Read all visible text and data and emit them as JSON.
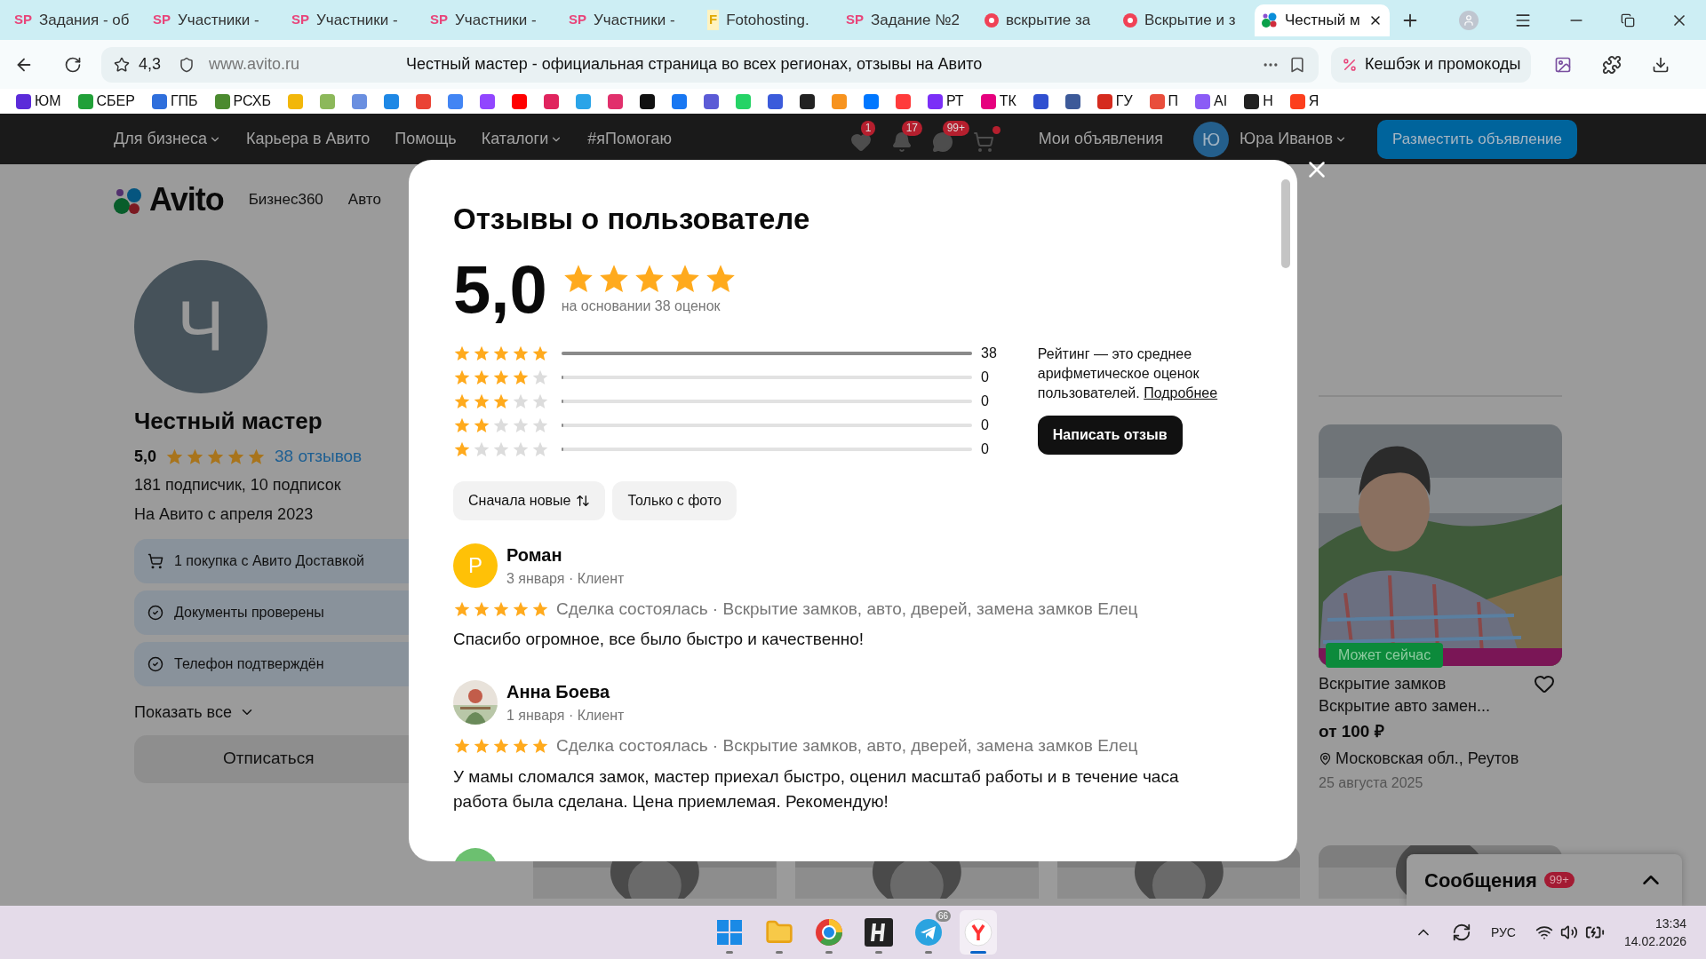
{
  "browser": {
    "tabs": [
      {
        "label": "Задания - об",
        "kind": "letters",
        "icon_text": "SP",
        "selected": false
      },
      {
        "label": "Участники - ",
        "kind": "letters",
        "icon_text": "SP",
        "selected": false
      },
      {
        "label": "Участники - ",
        "kind": "letters",
        "icon_text": "SP",
        "selected": false
      },
      {
        "label": "Участники - ",
        "kind": "letters",
        "icon_text": "SP",
        "selected": false
      },
      {
        "label": "Участники - ",
        "kind": "letters",
        "icon_text": "SP",
        "selected": false
      },
      {
        "label": "Fotohosting.",
        "kind": "letters",
        "icon_text": "F",
        "selected": false
      },
      {
        "label": "Задание №2",
        "kind": "letters",
        "icon_text": "SP",
        "selected": false
      },
      {
        "label": "вскрытие за",
        "kind": "dot",
        "selected": false
      },
      {
        "label": "Вскрытие и з",
        "kind": "dot",
        "selected": false
      },
      {
        "label": "Честный м",
        "kind": "avito",
        "selected": true
      }
    ],
    "address": {
      "rating": "4,3",
      "url": "www.avito.ru",
      "page_title": "Честный мастер - официальная страница во всех регионах, отзывы на Авито",
      "cashback": "Кешбэк и промокоды"
    },
    "bookmarks": [
      {
        "label": "ЮМ",
        "color": "#5b2bd9"
      },
      {
        "label": "СБЕР",
        "color": "#21a038"
      },
      {
        "label": "ГПБ",
        "color": "#2f6fdc"
      },
      {
        "label": "РСХБ",
        "color": "#4b8a2f"
      },
      {
        "color": "#f2b70a"
      },
      {
        "color": "#8cb85a"
      },
      {
        "color": "#6a8fe0"
      },
      {
        "color": "#1e88e5"
      },
      {
        "color": "#ea4335"
      },
      {
        "color": "#4285f4"
      },
      {
        "color": "#9146ff"
      },
      {
        "color": "#ff0000"
      },
      {
        "color": "#e0245e"
      },
      {
        "color": "#2aa4e8"
      },
      {
        "color": "#e1306c"
      },
      {
        "color": "#111111"
      },
      {
        "color": "#1877f2"
      },
      {
        "color": "#5b5bd6"
      },
      {
        "color": "#25d366"
      },
      {
        "color": "#3b5bdb"
      },
      {
        "color": "#222222"
      },
      {
        "color": "#f7931e"
      },
      {
        "color": "#0077ff"
      },
      {
        "color": "#ff3b3b"
      },
      {
        "label": "РТ",
        "color": "#7b2ff7"
      },
      {
        "label": "ТК",
        "color": "#e6007e"
      },
      {
        "color": "#3050d0"
      },
      {
        "color": "#3d5a99"
      },
      {
        "label": "ГУ",
        "color": "#d52b1e"
      },
      {
        "label": "П",
        "color": "#e94e3c"
      },
      {
        "label": "AI",
        "color": "#8b5cf6"
      },
      {
        "label": "Н",
        "color": "#222222"
      },
      {
        "label": "Я",
        "color": "#fc3f1d"
      }
    ]
  },
  "site_nav": {
    "links": [
      {
        "label": "Для бизнеса",
        "dropdown": true
      },
      {
        "label": "Карьера в Авито",
        "dropdown": false
      },
      {
        "label": "Помощь",
        "dropdown": false
      },
      {
        "label": "Каталоги",
        "dropdown": true
      },
      {
        "label": "#яПомогаю",
        "dropdown": false
      }
    ],
    "icons": [
      {
        "kind": "heart",
        "badge": "1",
        "dot": false
      },
      {
        "kind": "bell",
        "badge": "17",
        "dot": false
      },
      {
        "kind": "chat",
        "badge": "99+",
        "dot": false
      },
      {
        "kind": "cart",
        "dot": true
      }
    ],
    "my_ads": "Мои объявления",
    "user_initial": "Ю",
    "user_name": "Юра Иванов",
    "post_button": "Разместить объявление"
  },
  "header": {
    "logo": "Avito",
    "links": [
      "Бизнес360",
      "Авто"
    ]
  },
  "profile": {
    "initial": "Ч",
    "name": "Честный мастер",
    "rating": "5,0",
    "stars": 5,
    "reviews_link": "38 отзывов",
    "followers": "181 подписчик, 10 подписок",
    "since": "На Авито с апреля 2023",
    "badges": [
      {
        "kind": "cart",
        "label": "1 покупка с Авито Доставкой"
      },
      {
        "kind": "check",
        "label": "Документы проверены"
      },
      {
        "kind": "check",
        "label": "Телефон подтверждён"
      }
    ],
    "show_all": "Показать все",
    "unsubscribe": "Отписаться"
  },
  "listing": {
    "badge": "Может сейчас",
    "title": "Вскрытие замков",
    "subtitle": "Вскрытие авто замен...",
    "price": "от 100 ₽",
    "location": "Московская обл., Реутов",
    "date": "25 августа 2025",
    "favorite": false
  },
  "messages": {
    "label": "Сообщения",
    "badge": "99+"
  },
  "modal": {
    "title": "Отзывы о пользователе",
    "rating": "5,0",
    "stars": 5,
    "based_on": "на основании 38 оценок",
    "distribution": [
      {
        "stars": 5,
        "level": 1,
        "count": "38"
      },
      {
        "stars": 4,
        "level": 0,
        "count": "0"
      },
      {
        "stars": 3,
        "level": 0,
        "count": "0"
      },
      {
        "stars": 2,
        "level": 0,
        "count": "0"
      },
      {
        "stars": 1,
        "level": 0,
        "count": "0"
      }
    ],
    "note": "Рейтинг — это среднее арифметическое оценок пользователей.",
    "note_link": "Подробнее",
    "write_button": "Написать отзыв",
    "filters": [
      {
        "label": "Сначала новые",
        "sort_icon": true
      },
      {
        "label": "Только с фото",
        "sort_icon": false
      }
    ],
    "reviews": [
      {
        "kind": "letter",
        "initial": "Р",
        "name": "Роман",
        "meta": "3 января · Клиент",
        "stars": 5,
        "deal": "Сделка состоялась · Вскрытие замков, авто, дверей, замена замков Елец",
        "text": "Спасибо огромное, все было быстро и качественно!"
      },
      {
        "name": "Анна Боева",
        "meta": "1 января · Клиент",
        "stars": 5,
        "deal": "Сделка состоялась · Вскрытие замков, авто, дверей, замена замков Елец",
        "text": "У мамы сломался замок, мастер приехал быстро, оценил масштаб работы и в течение часа работа была сделана. Цена приемлемая. Рекомендую!"
      }
    ]
  },
  "taskbar": {
    "apps": [
      {
        "kind": "windows",
        "selected": false
      },
      {
        "kind": "folder",
        "selected": false
      },
      {
        "kind": "browser",
        "selected": false
      },
      {
        "kind": "h",
        "selected": false
      },
      {
        "kind": "telegram",
        "badge": "66",
        "selected": false
      },
      {
        "kind": "yandex",
        "selected": true
      }
    ],
    "language": "РУС",
    "time": "13:34",
    "date": "14.02.2026"
  }
}
